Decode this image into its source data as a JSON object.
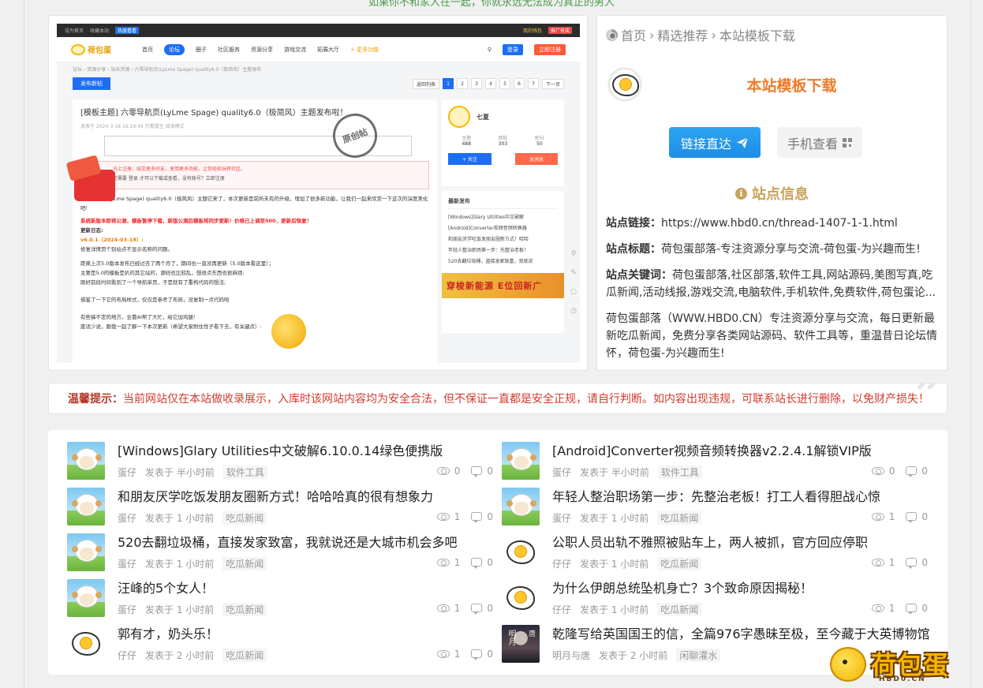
{
  "top_banner": "如果你不和家人在一起，你就永远无法成为真正的男人",
  "preview": {
    "topbar": {
      "left": [
        "设为首页",
        "收藏本站"
      ],
      "hot": "热度看看",
      "wallet": "我的钱包",
      "ad": "推广有奖"
    },
    "logo_text": "荷包蛋",
    "nav": [
      "首页",
      "论坛",
      "圈子",
      "社区服务",
      "资源分享",
      "游戏交流",
      "拓展大厅",
      "+ 更多功能"
    ],
    "login": "登录",
    "register": "立即注册",
    "crumb": "论坛 › 资源分享 › 站长资源 › 六零导航页(LyLme Spage) quality6.0（极简风）主题发布",
    "post_button": "发布新帖",
    "pages": [
      "返回列表",
      "1",
      "2",
      "3",
      "4",
      "5",
      "6",
      "7",
      "下一页"
    ],
    "post_title": "[模板主题] 六零导航页(LyLme Spage) quality6.0（极简风）主题发布啦！",
    "post_meta": "发表于 2024-3-18 16:19:49   只看楼主   阅读模式",
    "stamp": "原创帖",
    "notice_line1": "马上注册，结交更多好友，享用更多功能，让你轻松玩转社区。",
    "notice_line2": "您需要 登录 才可以下载或查看，没有账号？立即注册",
    "body_lines": [
      "六零导航页(LyLme Spage) quality6.0（极简风）主题它来了，本次更新是前所未有的升级，增加了很多新功能，让我们一起来欣赏一下这次的深度美化吧!",
      "系统新版本即将公测，模板暂停下载，新版公测后模板将同步更新！价格已上调至500，更新后恢复！",
      "更新日志:",
      "v6.0.1（2024-03-18）:",
      "修复详情页个别站点不显示名称的问题。",
      "距离上次5.0版本发布已经过去了两个月了，期间也一直没再更新（5.0版本看这里）；",
      "主要是5.0的模板是扒的其它站的，源码也比较乱，想改点东西也很麻烦;",
      "刚好前段时间看到了一个导航单页，于是就有了重构代码的想法;",
      "借鉴了一下它的布局样式，仅仅是参考了布局，没复制一点代码哈",
      "有些搞不定的地方，全靠AI帮了大忙，给它加鸡腿!",
      "废话少说，跟我一起了解一下本次更新（希望大家耐住性子看下去，有关键点）:"
    ],
    "user": {
      "name": "七夏",
      "stats": [
        {
          "k": "主题",
          "v": "488"
        },
        {
          "k": "回帖",
          "v": "303"
        },
        {
          "k": "积分",
          "v": "50"
        }
      ],
      "follow": "+ 关注",
      "message": "发消息"
    },
    "latest_title": "最新发布",
    "latest": [
      "[Windows]Glary Utilities中文破解",
      "[Android]Converter视频音频转换器",
      "和朋友厌学吃饭发朋友圈新方式！哈哈",
      "年轻人整治职场第一步：先整治老板！",
      "520去翻垃圾桶，直接发家致富，我就说"
    ],
    "ad_text": "穿梭新能源 E位回新广"
  },
  "site": {
    "breadcrumb": [
      "首页",
      "精选推荐",
      "本站模板下载"
    ],
    "name": "本站模板下载",
    "visit_button": "链接直达",
    "mobile_button": "手机查看",
    "section_title": "站点信息",
    "link_label": "站点链接：",
    "link": "https://www.hbd0.cn/thread-1407-1-1.html",
    "title_label": "站点标题：",
    "title": "荷包蛋部落-专注资源分享与交流-荷包蛋-为兴趣而生!",
    "keywords_label": "站点关键词：",
    "keywords": "荷包蛋部落,社区部落,软件工具,网站源码,美图写真,吃瓜新闻,活动线报,游戏交流,电脑软件,手机软件,免费软件,荷包蛋论...",
    "description": "荷包蛋部落（WWW.HBD0.CN）专注资源分享与交流，每日更新最新吃瓜新闻，免费分享各类网站源码、软件工具等，重温昔日论坛情怀，荷包蛋-为兴趣而生!"
  },
  "warning": {
    "label": "温馨提示：",
    "text": "当前网站仅在本站做收录展示，入库时该网站内容均为安全合法，但不保证一直都是安全正规，请自行判断。如内容出现违规，可联系站长进行删除，以免财产损失！"
  },
  "articles": [
    {
      "thumb": "sheep",
      "title": "[Windows]Glary Utilities中文破解6.10.0.14绿色便携版",
      "author": "蛋仔",
      "time": "发表于 半小时前",
      "category": "软件工具",
      "views": "0",
      "comments": "0"
    },
    {
      "thumb": "sheep",
      "title": "[Android]Converter视频音频转换器v2.2.4.1解锁VIP版",
      "author": "蛋仔",
      "time": "发表于 半小时前",
      "category": "软件工具",
      "views": "0",
      "comments": "0"
    },
    {
      "thumb": "sheep",
      "title": "和朋友厌学吃饭发朋友圈新方式！哈哈哈真的很有想象力",
      "author": "蛋仔",
      "time": "发表于 1 小时前",
      "category": "吃瓜新闻",
      "views": "1",
      "comments": "0"
    },
    {
      "thumb": "sheep",
      "title": "年轻人整治职场第一步：先整治老板！打工人看得胆战心惊",
      "author": "蛋仔",
      "time": "发表于 1 小时前",
      "category": "吃瓜新闻",
      "views": "1",
      "comments": "0"
    },
    {
      "thumb": "sheep",
      "title": "520去翻垃圾桶，直接发家致富，我就说还是大城市机会多吧",
      "author": "蛋仔",
      "time": "发表于 1 小时前",
      "category": "吃瓜新闻",
      "views": "1",
      "comments": "0"
    },
    {
      "thumb": "egg",
      "title": "公职人员出轨不雅照被贴车上，两人被抓，官方回应停职",
      "author": "仔仔",
      "time": "发表于 1 小时前",
      "category": "吃瓜新闻",
      "views": "1",
      "comments": "0"
    },
    {
      "thumb": "sheep",
      "title": "汪峰的5个女人！",
      "author": "蛋仔",
      "time": "发表于 1 小时前",
      "category": "吃瓜新闻",
      "views": "1",
      "comments": "0"
    },
    {
      "thumb": "egg",
      "title": "为什么伊朗总统坠机身亡？3个致命原因揭秘！",
      "author": "仔仔",
      "time": "发表于 1 小时前",
      "category": "吃瓜新闻",
      "views": "1",
      "comments": "0"
    },
    {
      "thumb": "egg",
      "title": "郭有才，奶头乐！",
      "author": "仔仔",
      "time": "发表于 2 小时前",
      "category": "吃瓜新闻",
      "views": "1",
      "comments": "0"
    },
    {
      "thumb": "photo",
      "title": "乾隆写给英国国王的信，全篇976字愚昧至极，至今藏于大英博物馆",
      "author": "明月与唐",
      "time": "发表于 2 小时前",
      "category": "闲聊灌水",
      "views": "",
      "comments": ""
    }
  ],
  "watermark": {
    "brand": "荷包蛋",
    "domain": "HBD0.CN"
  },
  "colors": {
    "accent": "#1e8ee6",
    "site_name": "#f07b2a",
    "section": "#c9a35a",
    "warning": "#d13b2e"
  }
}
